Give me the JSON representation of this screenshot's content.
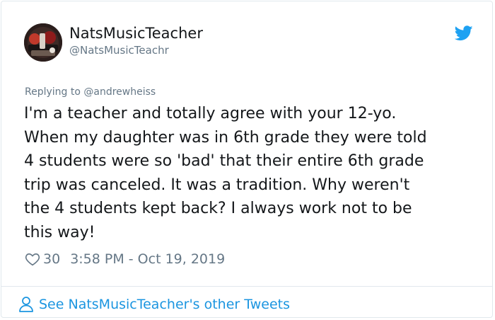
{
  "author": {
    "display_name": "NatsMusicTeacher",
    "handle": "@NatsMusicTeachr"
  },
  "tweet": {
    "replying_to": "Replying to @andrewheiss",
    "lines": [
      "I'm a teacher and totally agree with your 12-yo.",
      "When my daughter was in 6th grade they were told",
      "4 students were so 'bad' that their entire 6th grade",
      "trip was canceled. It was a tradition. Why weren't",
      "the 4 students kept back? I always work not to be",
      "this way!"
    ],
    "like_count": "30",
    "timestamp": "3:58 PM - Oct 19, 2019"
  },
  "footer": {
    "other_tweets_link": "See NatsMusicTeacher's other Tweets"
  },
  "icons": {
    "brand": "twitter-bird-icon",
    "like": "heart-icon",
    "profile": "person-icon"
  },
  "colors": {
    "brand_blue": "#1da1f2",
    "link_blue": "#1b95e0",
    "text": "#14171a",
    "muted": "#657786",
    "border": "#e1e8ed"
  }
}
